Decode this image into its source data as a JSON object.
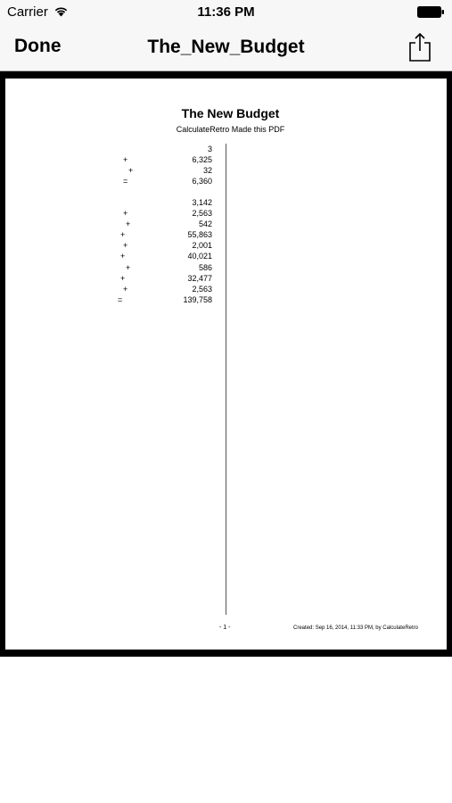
{
  "status_bar": {
    "carrier": "Carrier",
    "time": "11:36 PM"
  },
  "nav": {
    "done_label": "Done",
    "title": "The_New_Budget"
  },
  "document": {
    "title": "The New Budget",
    "subtitle": "CalculateRetro Made this PDF",
    "calculations": [
      {
        "rows": [
          {
            "op": "",
            "value": "3"
          },
          {
            "op": "+",
            "value": "6,325"
          },
          {
            "op": "+",
            "value": "32"
          },
          {
            "op": "=",
            "value": "6,360"
          }
        ]
      },
      {
        "rows": [
          {
            "op": "",
            "value": "3,142"
          },
          {
            "op": "+",
            "value": "2,563"
          },
          {
            "op": "+",
            "value": "542"
          },
          {
            "op": "+",
            "value": "55,863"
          },
          {
            "op": "+",
            "value": "2,001"
          },
          {
            "op": "+",
            "value": "40,021"
          },
          {
            "op": "+",
            "value": "586"
          },
          {
            "op": "+",
            "value": "32,477"
          },
          {
            "op": "+",
            "value": "2,563"
          },
          {
            "op": "=",
            "value": "139,758"
          }
        ]
      }
    ],
    "page_number": "- 1 -",
    "created": "Created: Sep 16, 2014, 11:33 PM, by CalculateRetro"
  }
}
